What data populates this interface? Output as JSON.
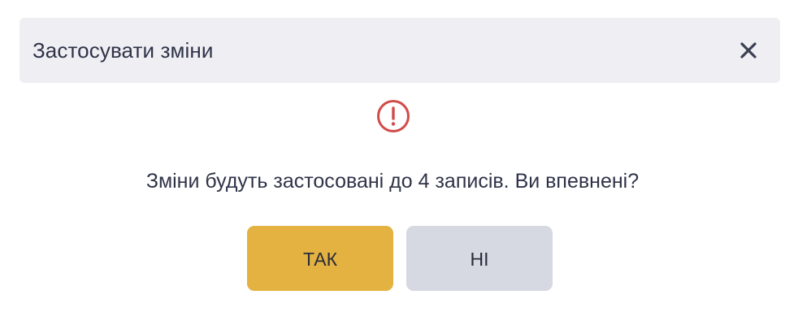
{
  "dialog": {
    "title": "Застосувати зміни",
    "message": "Зміни будуть застосовані до 4 записів. Ви впевнені?",
    "buttons": {
      "yes_label": "ТАК",
      "no_label": "НІ"
    },
    "icons": {
      "close": "close-icon",
      "alert": "alert-icon"
    }
  },
  "colors": {
    "header_bg": "#eeeef3",
    "text": "#2f3348",
    "alert": "#d24b48",
    "yes_bg": "#e3b241",
    "no_bg": "#d6d8e2"
  }
}
